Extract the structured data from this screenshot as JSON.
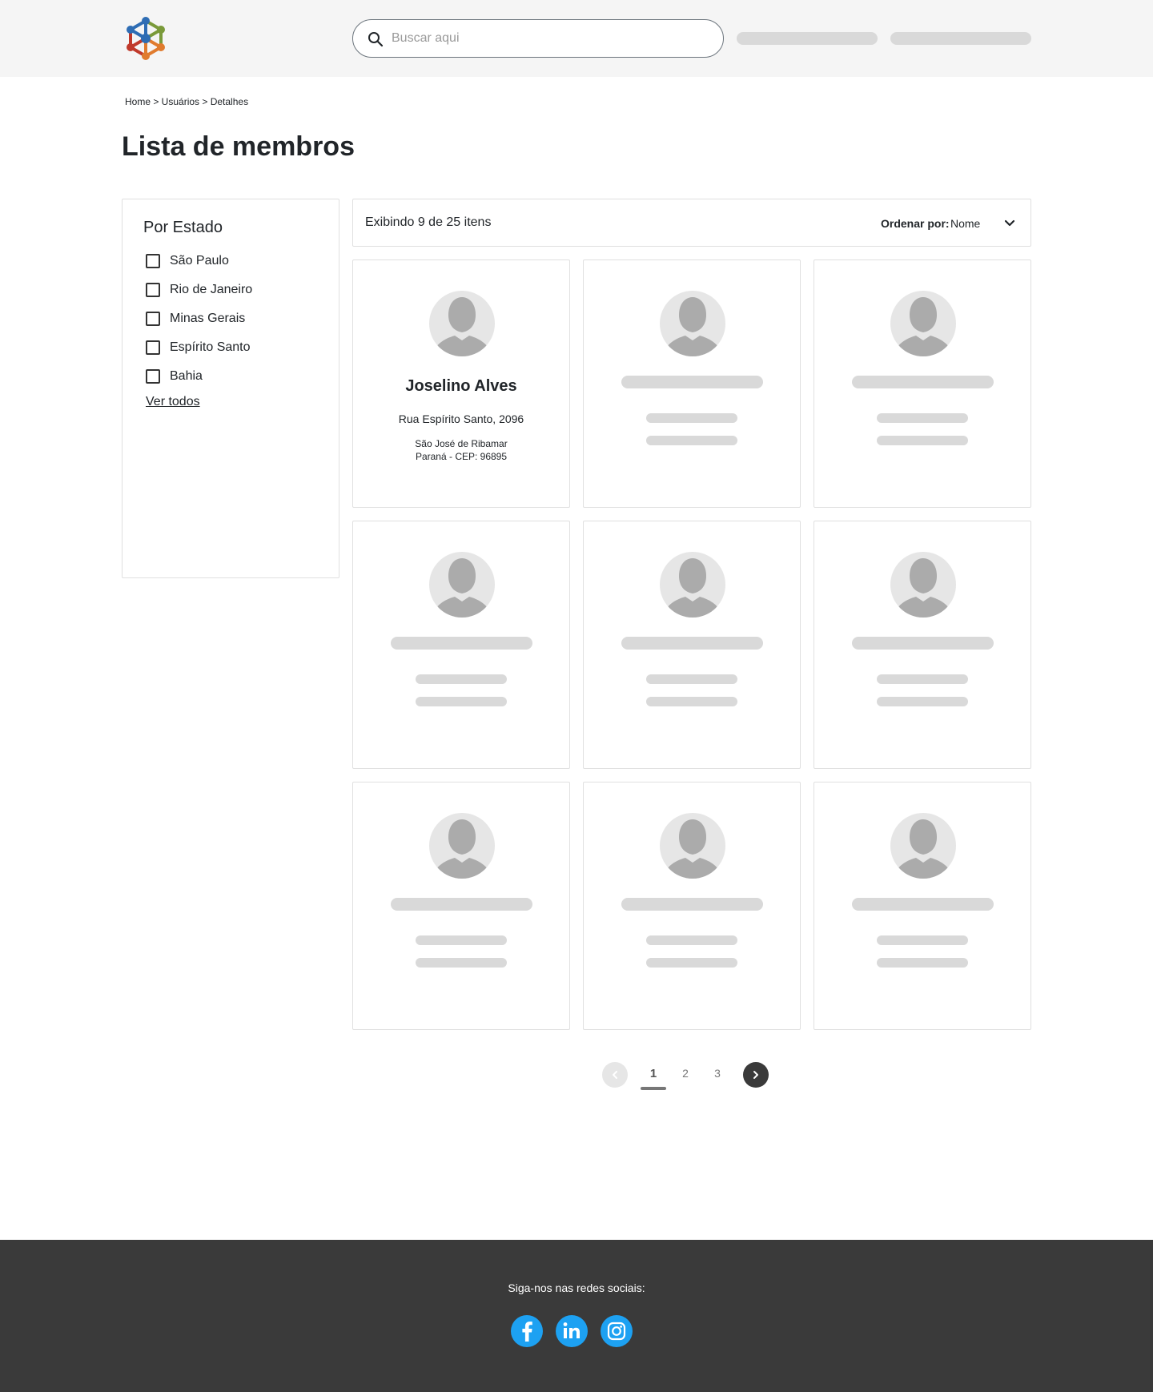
{
  "colors": {
    "header_bg": "#f5f5f5",
    "footer_bg": "#3a3a3a",
    "social_blue": "#1da1f2",
    "skeleton": "#d9d9d9",
    "text": "#212529"
  },
  "header": {
    "logo_icon": "molecule-logo-icon",
    "search": {
      "placeholder": "Buscar aqui",
      "value": "",
      "icon": "search-icon"
    }
  },
  "breadcrumb": "Home > Usuários > Detalhes",
  "page_title": "Lista de membros",
  "filter": {
    "title": "Por Estado",
    "options": [
      {
        "label": "São Paulo",
        "checked": false
      },
      {
        "label": "Rio de Janeiro",
        "checked": false
      },
      {
        "label": "Minas Gerais",
        "checked": false
      },
      {
        "label": "Espírito Santo",
        "checked": false
      },
      {
        "label": "Bahia",
        "checked": false
      }
    ],
    "see_all": "Ver todos"
  },
  "toolbar": {
    "showing": "Exibindo 9 de  25 itens",
    "sort_label": "Ordenar por:",
    "sort_value": "Nome"
  },
  "cards": [
    {
      "name": "Joselino Alves",
      "street": "Rua Espírito Santo, 2096",
      "city": "São José de Ribamar",
      "state": "Paraná - CEP: 96895"
    }
  ],
  "pagination": {
    "pages": [
      "1",
      "2",
      "3"
    ],
    "current": "1",
    "prev_icon": "chevron-left-icon",
    "next_icon": "chevron-right-icon"
  },
  "footer": {
    "follow_text": "Siga-nos nas redes sociais:",
    "socials": [
      "facebook-icon",
      "linkedin-icon",
      "instagram-icon"
    ]
  }
}
